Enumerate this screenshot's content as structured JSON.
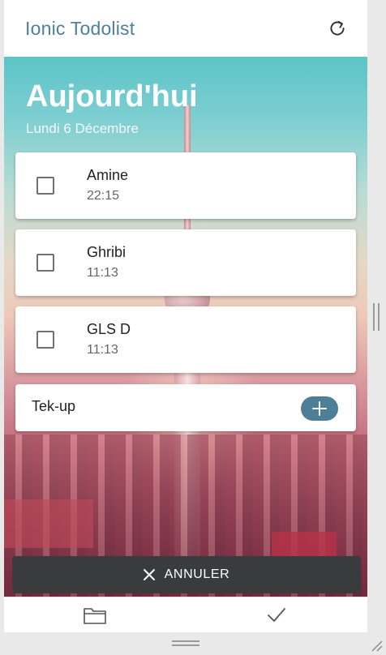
{
  "header": {
    "title": "Ionic Todolist",
    "refresh_icon": "refresh-icon"
  },
  "hero": {
    "title": "Aujourd'hui",
    "date": "Lundi 6 Décembre"
  },
  "todos": [
    {
      "name": "Amine",
      "time": "22:15",
      "checked": false
    },
    {
      "name": "Ghribi",
      "time": "11:13",
      "checked": false
    },
    {
      "name": "GLS D",
      "time": "11:13",
      "checked": false
    }
  ],
  "add_form": {
    "value": "Tek-up",
    "button_icon": "plus-icon"
  },
  "snackbar": {
    "label": "ANNULER",
    "icon": "close-icon"
  },
  "tabs": [
    {
      "icon": "folder-icon"
    },
    {
      "icon": "checkmark-icon"
    }
  ],
  "colors": {
    "accent": "#4d7f97",
    "title": "#4e7f9c",
    "snackbar": "#3a3b3d"
  }
}
